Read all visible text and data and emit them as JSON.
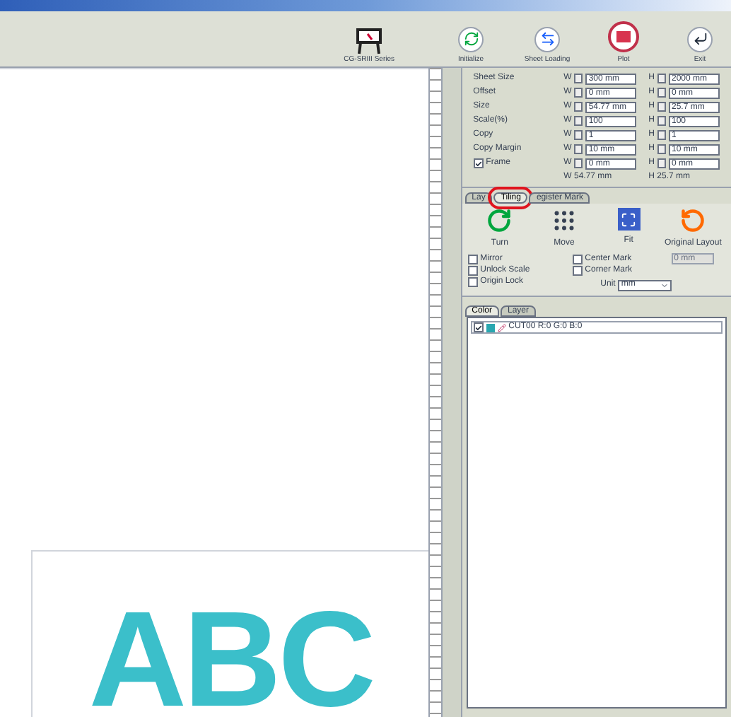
{
  "toolbar": {
    "model": {
      "label": "CG-SRIII Series"
    },
    "buttons": [
      {
        "kind": "initialize",
        "label": "Initialize"
      },
      {
        "kind": "sheet",
        "label": "Sheet Loading"
      },
      {
        "kind": "plot",
        "label": "Plot"
      },
      {
        "kind": "exit",
        "label": "Exit"
      }
    ]
  },
  "canvas": {
    "artwork_text": "ABC"
  },
  "settings": {
    "rows": [
      {
        "label": "Sheet Size",
        "w": {
          "prefix": "W",
          "value": "300 mm"
        },
        "h": {
          "prefix": "H",
          "value": "2000 mm"
        }
      },
      {
        "label": "Offset",
        "w": {
          "prefix": "W",
          "value": "0 mm"
        },
        "h": {
          "prefix": "H",
          "value": "0 mm"
        }
      },
      {
        "label": "Size",
        "w": {
          "prefix": "W",
          "value": "54.77 mm"
        },
        "h": {
          "prefix": "H",
          "value": "25.7 mm"
        }
      },
      {
        "label": "Scale(%)",
        "w": {
          "prefix": "W",
          "value": "100"
        },
        "h": {
          "prefix": "H",
          "value": "100"
        }
      },
      {
        "label": "Copy",
        "w": {
          "prefix": "W",
          "value": "1"
        },
        "h": {
          "prefix": "H",
          "value": "1"
        }
      },
      {
        "label": "Copy Margin",
        "w": {
          "prefix": "W",
          "value": "10 mm"
        },
        "h": {
          "prefix": "H",
          "value": "10 mm"
        }
      },
      {
        "label": "Frame",
        "checked": true,
        "w": {
          "prefix": "W",
          "value": "0 mm"
        },
        "h": {
          "prefix": "H",
          "value": "0 mm"
        }
      }
    ],
    "summary": [
      "W 54.77 mm",
      "H 25.7 mm"
    ]
  },
  "tabs": [
    {
      "label": "Lay",
      "selected": false
    },
    {
      "label": "Tiling",
      "selected": true,
      "circled": true
    },
    {
      "label": "egister Mark",
      "selected": false
    }
  ],
  "tools": [
    {
      "kind": "turn",
      "label": "Turn"
    },
    {
      "kind": "move",
      "label": "Move"
    },
    {
      "kind": "fit",
      "label": "Fit"
    },
    {
      "kind": "original",
      "label": "Original Layout"
    }
  ],
  "options_left": [
    {
      "label": "Mirror",
      "checked": false
    },
    {
      "label": "Unlock Scale",
      "checked": false
    },
    {
      "label": "Origin Lock",
      "checked": false
    }
  ],
  "options_right": [
    {
      "label": "Center Mark",
      "checked": false
    },
    {
      "label": "Corner Mark",
      "checked": false
    }
  ],
  "mark_size": {
    "value": "0 mm",
    "disabled": true
  },
  "unit": {
    "label": "Unit",
    "value": "mm"
  },
  "layer_tabs": [
    {
      "label": "Color",
      "selected": true
    },
    {
      "label": "Layer",
      "selected": false
    }
  ],
  "layers": [
    {
      "name": "CUT00 R:0 G:0 B:0",
      "checked": true,
      "color": "#2aa7b0"
    }
  ]
}
